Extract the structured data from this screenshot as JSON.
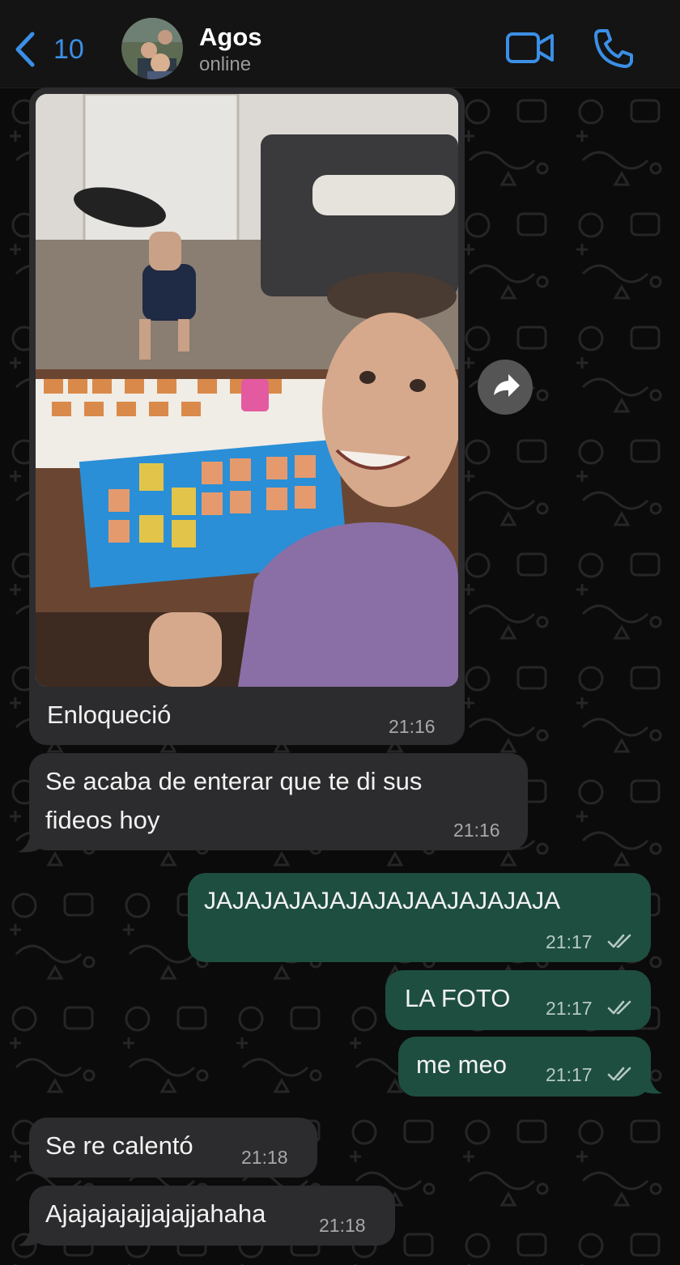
{
  "header": {
    "back_count": "10",
    "contact_name": "Agos",
    "contact_status": "online",
    "accent_color": "#3b8fe6"
  },
  "messages": [
    {
      "type": "in",
      "kind": "image",
      "caption": "Enloqueció",
      "time": "21:16"
    },
    {
      "type": "in",
      "text_line1": "Se acaba de enterar que te di sus",
      "text_line2": "fideos hoy",
      "time": "21:16"
    },
    {
      "type": "out",
      "text": "JAJAJAJAJAJAJAJAAJAJAJAJA",
      "time": "21:17",
      "status": "read"
    },
    {
      "type": "out",
      "text": "LA FOTO",
      "time": "21:17",
      "status": "read"
    },
    {
      "type": "out",
      "text": "me meo",
      "time": "21:17",
      "status": "read"
    },
    {
      "type": "in",
      "text": "Se re calentó",
      "time": "21:18"
    },
    {
      "type": "in",
      "text": "Ajajajajajjajajjahaha",
      "time": "21:18"
    }
  ],
  "colors": {
    "incoming_bubble": "#2c2c2e",
    "outgoing_bubble": "#1e4e40",
    "background": "#0b0b0b"
  },
  "icons": [
    "chevron-left-icon",
    "video-camera-icon",
    "phone-icon",
    "forward-icon",
    "double-check-icon"
  ]
}
